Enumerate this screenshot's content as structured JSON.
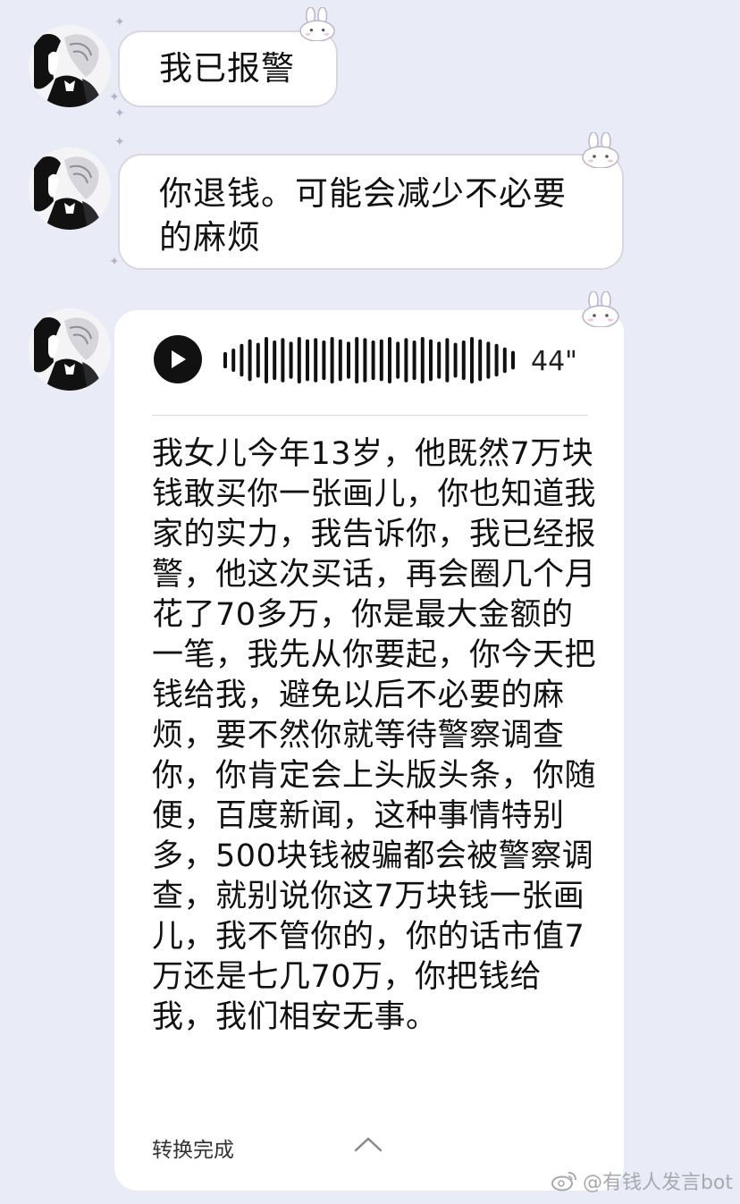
{
  "messages": [
    {
      "text": "我已报警"
    },
    {
      "text": "你退钱。可能会减少不必要的麻烦"
    }
  ],
  "voice": {
    "duration": "44\"",
    "transcript": "我女儿今年13岁，他既然7万块钱敢买你一张画儿，你也知道我家的实力，我告诉你，我已经报警，他这次买话，再会圈几个月花了70多万，你是最大金额的一笔，我先从你要起，你今天把钱给我，避免以后不必要的麻烦，要不然你就等待警察调查你，你肯定会上头版头条，你随便，百度新闻，这种事情特别多，500块钱被骗都会被警察调查，就别说你这7万块钱一张画儿，我不管你的，你的话市值7万还是七几70万，你把钱给我，我们相安无事。",
    "status": "转换完成"
  },
  "watermark": "@有钱人发言bot",
  "icons": {
    "play": "play-icon",
    "waveform": "waveform-icon",
    "collapse": "chevron-up-icon",
    "weibo": "weibo-logo-icon",
    "bunny": "bunny-decoration-icon"
  },
  "colors": {
    "background": "#e9ecf7",
    "bubble": "#ffffff",
    "text": "#111111",
    "watermark": "#a7a9ad"
  }
}
